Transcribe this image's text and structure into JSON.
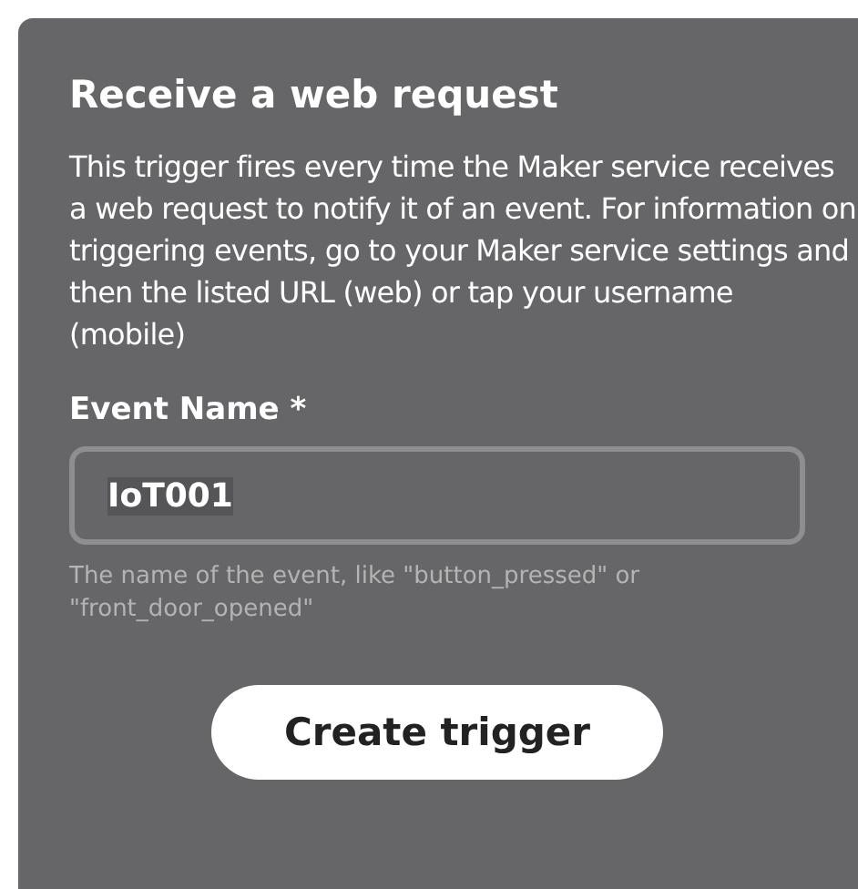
{
  "card": {
    "title": "Receive a web request",
    "description": "This trigger fires every time the Maker service receives a web request to notify it of an event. For information on triggering events, go to your Maker service settings and then the listed URL (web) or tap your username (mobile)",
    "field": {
      "label": "Event Name *",
      "value": "IoT001",
      "selected": true,
      "help": "The name of the event, like \"button_pressed\" or \"front_door_opened\""
    },
    "button": "Create trigger"
  }
}
